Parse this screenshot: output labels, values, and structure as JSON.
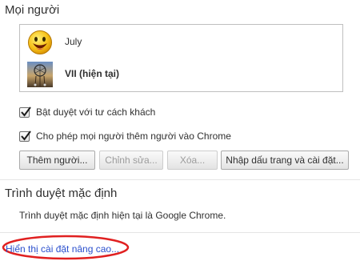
{
  "people": {
    "title": "Mọi người",
    "profiles": [
      {
        "name": "July",
        "avatar": "smiley-face-icon",
        "current": false
      },
      {
        "name": "VII (hiện tại)",
        "avatar": "dreamcatcher-photo-avatar",
        "current": true
      }
    ],
    "guest_browsing_label": "Bật duyệt với tư cách khách",
    "guest_browsing_checked": true,
    "allow_add_people_label": "Cho phép mọi người thêm người vào Chrome",
    "allow_add_people_checked": true,
    "buttons": {
      "add": "Thêm người...",
      "edit": "Chỉnh sửa...",
      "delete": "Xóa...",
      "import": "Nhập dấu trang và cài đặt..."
    }
  },
  "default_browser": {
    "title": "Trình duyệt mặc định",
    "status": "Trình duyệt mặc định hiện tại là Google Chrome."
  },
  "advanced_link": "Hiển thị cài đặt nâng cao...",
  "colors": {
    "link": "#2a4fcd",
    "highlight_ellipse": "#e02020",
    "list_border": "#bfbfbf"
  }
}
